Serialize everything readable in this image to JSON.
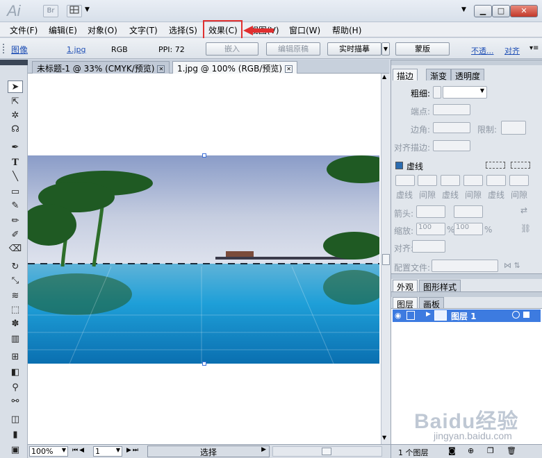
{
  "app": {
    "logo": "Ai",
    "bridge": "Br"
  },
  "window": {
    "minimize": "▁",
    "maximize": "□",
    "close": "✕"
  },
  "menu": {
    "items": [
      "文件(F)",
      "编辑(E)",
      "对象(O)",
      "文字(T)",
      "选择(S)",
      "效果(C)",
      "视图(V)",
      "窗口(W)",
      "帮助(H)"
    ],
    "highlighted": "效果(C)"
  },
  "controlbar": {
    "type": "图像",
    "file": "1.jpg",
    "mode": "RGB",
    "ppi": "PPI: 72",
    "embed": "嵌入",
    "edit_original": "编辑原稿",
    "live_trace": "实时描摹",
    "mask": "蒙版",
    "opacity": "不透...",
    "align": "对齐"
  },
  "doc_tabs": [
    {
      "label": "未标题-1 @ 33% (CMYK/预览)",
      "active": false
    },
    {
      "label": "1.jpg @ 100% (RGB/预览)",
      "active": true
    }
  ],
  "status": {
    "zoom": "100%",
    "page": "1",
    "label": "选择"
  },
  "stroke_panel": {
    "tabs": [
      "描边",
      "渐变",
      "透明度"
    ],
    "weight": "粗细:",
    "cap": "端点:",
    "corner": "边角:",
    "limit": "限制:",
    "align": "对齐描边:",
    "dashed": "虚线",
    "dash_labels": [
      "虚线",
      "间隙",
      "虚线",
      "间隙",
      "虚线",
      "间隙"
    ],
    "arrows": "箭头:",
    "scale": "缩放:",
    "scale_values": [
      "100",
      "100"
    ],
    "percent": "%",
    "align_arrow": "对齐:",
    "profile": "配置文件:"
  },
  "appearance_panel": {
    "tabs": [
      "外观",
      "图形样式"
    ]
  },
  "layers_panel": {
    "tabs": [
      "图层",
      "画板"
    ],
    "layers": [
      {
        "name": "图层 1"
      }
    ],
    "count": "1 个图层"
  },
  "watermark": {
    "brand": "Baidu经验",
    "url": "jingyan.baidu.com"
  },
  "colors": {
    "accent": "#3d7be0",
    "highlight_border": "#e03030",
    "water": "#1e9fd8"
  }
}
